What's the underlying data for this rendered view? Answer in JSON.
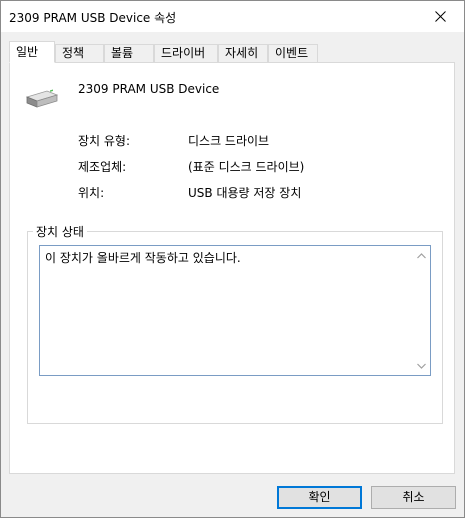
{
  "window": {
    "title": "2309 PRAM USB Device 속성",
    "close_icon": "close-icon"
  },
  "tabs": [
    {
      "label": "일반",
      "active": true
    },
    {
      "label": "정책",
      "active": false
    },
    {
      "label": "볼륨",
      "active": false
    },
    {
      "label": "드라이버",
      "active": false
    },
    {
      "label": "자세히",
      "active": false
    },
    {
      "label": "이벤트",
      "active": false
    }
  ],
  "general": {
    "device_icon": "drive-icon",
    "device_name": "2309 PRAM USB Device",
    "properties": [
      {
        "label": "장치 유형:",
        "value": "디스크 드라이브"
      },
      {
        "label": "제조업체:",
        "value": "(표준 디스크 드라이브)"
      },
      {
        "label": "위치:",
        "value": "USB 대용량 저장 장치"
      }
    ],
    "status_group_title": "장치 상태",
    "status_text": "이 장치가 올바르게 작동하고 있습니다."
  },
  "buttons": {
    "ok_label": "확인",
    "cancel_label": "취소"
  },
  "colors": {
    "accent": "#0078d7",
    "panel_background": "#ffffff",
    "window_background": "#f0f0f0"
  }
}
